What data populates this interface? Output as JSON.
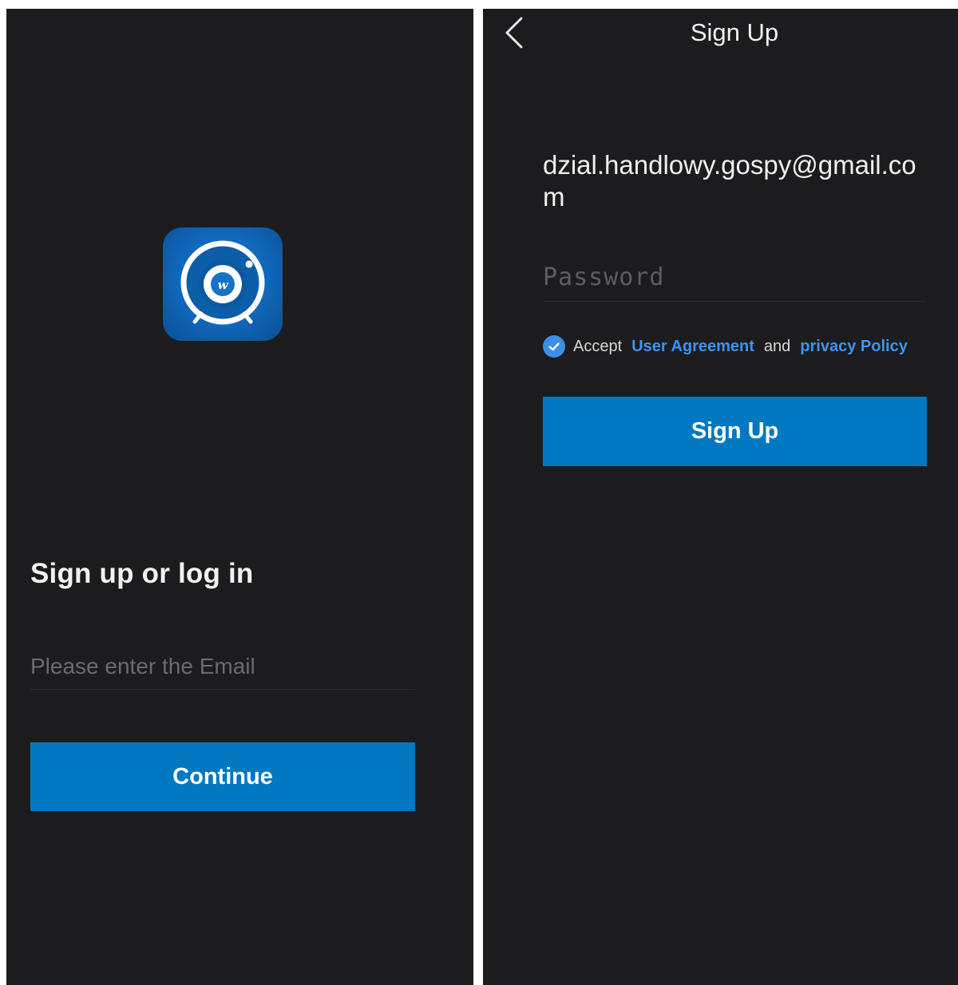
{
  "login_screen": {
    "title": "Sign up or log in",
    "email_placeholder": "Please enter the Email",
    "continue_label": "Continue",
    "logo_icon": "camera-app-logo-icon",
    "colors": {
      "background": "#1c1c1e",
      "accent": "#0278c2",
      "logo_blue": "#0f66b8"
    }
  },
  "signup_screen": {
    "header_title": "Sign Up",
    "back_icon": "chevron-left-icon",
    "email_value": "dzial.handlowy.gospy@gmail.com",
    "password_placeholder": "Password",
    "accept": {
      "checked": true,
      "prefix": "Accept",
      "user_agreement": "User Agreement",
      "conjunction": "and",
      "privacy_policy": "privacy Policy"
    },
    "signup_label": "Sign Up",
    "colors": {
      "link": "#3d94ee",
      "checkbox": "#3b8fe6",
      "button": "#0278c2"
    }
  }
}
